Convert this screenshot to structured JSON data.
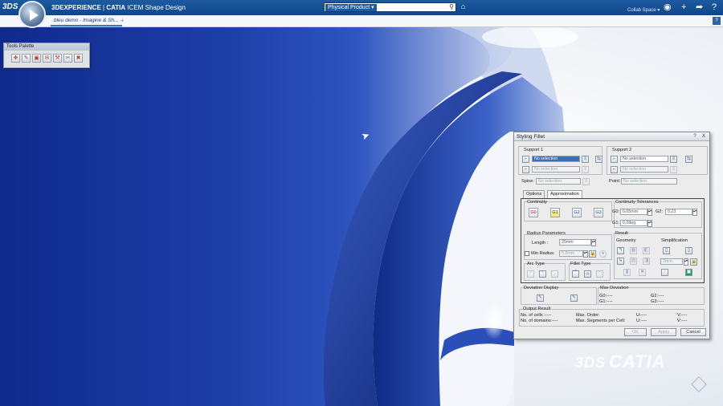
{
  "topbar": {
    "ds_logo": "3DS",
    "brand": "3DEXPERIENCE",
    "separator": " | ",
    "product": "CATIA",
    "app_name": " ICEM Shape Design",
    "search_scope": "Physical Product ▾",
    "search_placeholder": "",
    "collab_space": "Collab Space ▾"
  },
  "tabs": [
    {
      "label": "bleu demo - Imagine & Sh..."
    }
  ],
  "tools_palette": {
    "title": "Tools Palette",
    "tools": [
      "move-tool",
      "paint-tool",
      "select-tool",
      "open-tool",
      "measure-tool",
      "edit-tool",
      "delete-tool"
    ]
  },
  "watermark": {
    "mark": "3DS",
    "text": "CATIA"
  },
  "dialog": {
    "title": "Styling Fillet",
    "title_buttons": [
      "?",
      "X"
    ],
    "support1": {
      "label": "Support 1",
      "field1": "No selection",
      "field2": "No selection"
    },
    "support2": {
      "label": "Support 2",
      "field1": "No selection",
      "field2": "No selection"
    },
    "spine": {
      "label": "Spine:",
      "value": "No selection"
    },
    "point": {
      "label": "Point:",
      "value": "No selection"
    },
    "tabs": [
      "Options",
      "Approximation"
    ],
    "continuity": {
      "label": "Continuity",
      "buttons": [
        "G0",
        "G1",
        "G2",
        "G3"
      ]
    },
    "tolerances": {
      "label": "Continuity Tolerances",
      "g0_label": "G0:",
      "g0_value": "0,05mm",
      "g1_label": "G1:",
      "g1_value": "0,2deg",
      "g2_label": "G2:",
      "g2_value": "0,23"
    },
    "radius": {
      "label": "Radius Parameters",
      "length_label": "Length :",
      "length_value": "25mm",
      "min_radius_label": "Min Radius:",
      "min_radius_value": "0,8mm"
    },
    "result": {
      "label": "Result",
      "geometry_label": "Geometry",
      "simplification_label": "Simplification",
      "simpl_value": "2mm"
    },
    "arc_type_label": "Arc Type",
    "fillet_type_label": "Fillet Type",
    "deviation_display_label": "Deviation Display",
    "max_deviation": {
      "label": "Max Deviation",
      "g0": "G0:----",
      "g1": "G1:----",
      "g2": "G2:----",
      "g3": "G3:----"
    },
    "output": {
      "label": "Output Result",
      "cells": "No. of cells     :----",
      "domains": "No. of domains:----",
      "max_order": "Max. Order:",
      "max_segments": "Max. Segments per Cell:",
      "u1": "U:----",
      "u2": "U:----",
      "v1": "V:----",
      "v2": "V:----"
    },
    "buttons": {
      "ok": "OK",
      "apply": "Apply",
      "cancel": "Cancel"
    }
  }
}
